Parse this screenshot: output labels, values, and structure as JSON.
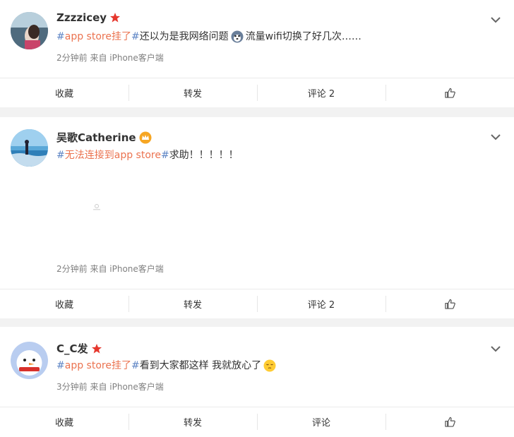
{
  "posts": [
    {
      "username": "Zzzzicey",
      "topic_hash_open": "#",
      "topic_text": "app store挂了",
      "topic_hash_close": "#",
      "text_before_emoji": "还以为是我网络问题",
      "text_after_emoji": "流量wifi切换了好几次……",
      "meta": "2分钟前 来自 iPhone客户端",
      "actions": {
        "favorite": "收藏",
        "repost": "转发",
        "comment": "评论 2"
      }
    },
    {
      "username": "吴歌Catherine",
      "topic_hash_open": "#",
      "topic_text": "无法连接到app store",
      "topic_hash_close": "#",
      "text_after": "求助！！！！！",
      "meta": "2分钟前 来自 iPhone客户端",
      "actions": {
        "favorite": "收藏",
        "repost": "转发",
        "comment": "评论 2"
      }
    },
    {
      "username": "C_C发",
      "topic_hash_open": "#",
      "topic_text": "app store挂了",
      "topic_hash_close": "#",
      "text_before_emoji": "看到大家都这样 我就放心了",
      "meta": "3分钟前 来自 iPhone客户端",
      "actions": {
        "favorite": "收藏",
        "repost": "转发",
        "comment": "评论"
      }
    }
  ],
  "colors": {
    "topic": "#eb7350",
    "hash": "#5d84c4",
    "badge": "#e6372d"
  }
}
